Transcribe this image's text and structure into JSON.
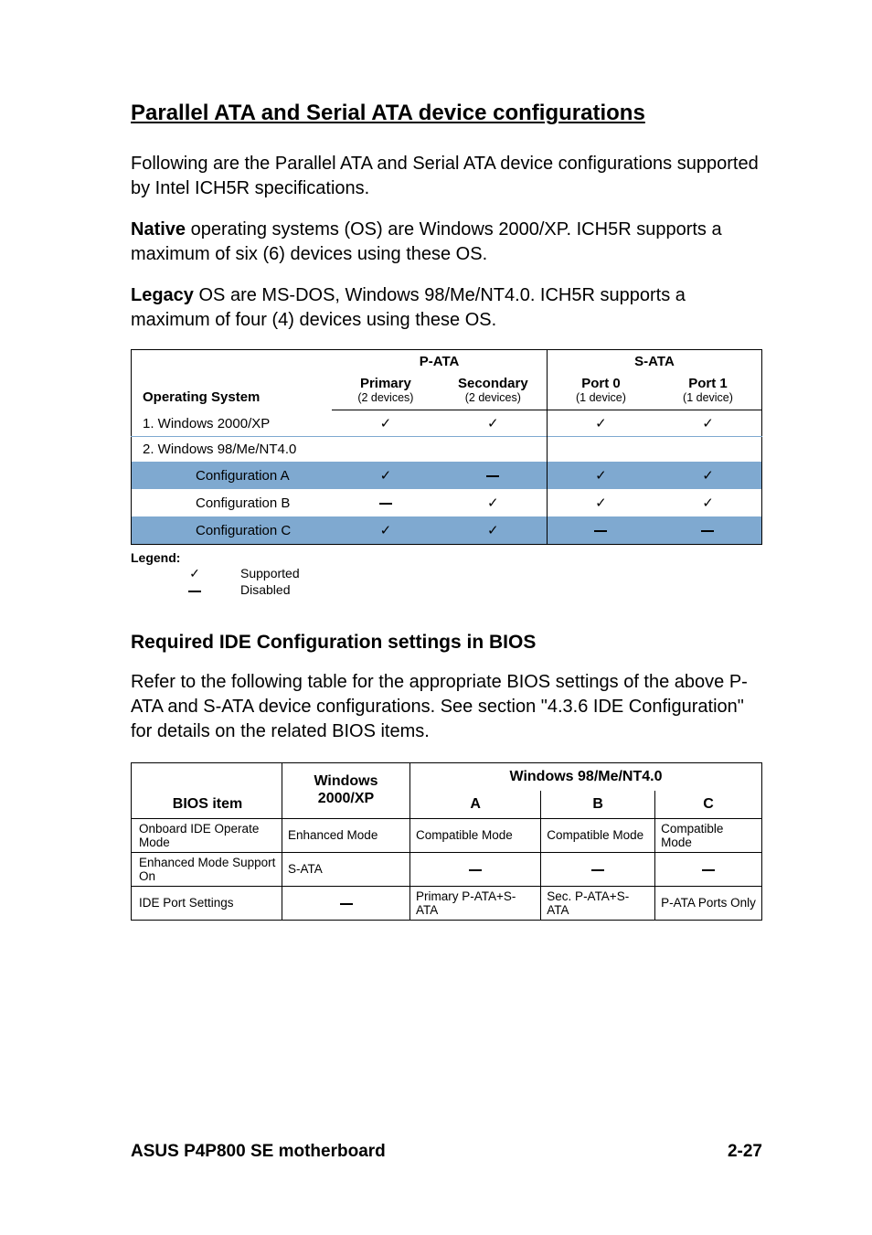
{
  "heading": "Parallel ATA and Serial ATA device configurations",
  "para1": "Following are the Parallel ATA and Serial ATA device configurations supported by Intel ICH5R specifications.",
  "para2_bold": "Native",
  "para2_rest": " operating systems (OS) are Windows 2000/XP. ICH5R supports a maximum of six (6) devices using these OS.",
  "para3_bold": "Legacy",
  "para3_rest": " OS are MS-DOS, Windows 98/Me/NT4.0. ICH5R supports a maximum of four (4) devices using these OS.",
  "t1": {
    "os_header": "Operating System",
    "pata": "P-ATA",
    "sata": "S-ATA",
    "primary": "Primary",
    "primary_sub": "(2 devices)",
    "secondary": "Secondary",
    "secondary_sub": "(2 devices)",
    "port0": "Port 0",
    "port0_sub": "(1 device)",
    "port1": "Port 1",
    "port1_sub": "(1 device)",
    "row1": "1.  Windows 2000/XP",
    "row2": "2.  Windows 98/Me/NT4.0",
    "cfgA": "Configuration A",
    "cfgB": "Configuration B",
    "cfgC": "Configuration C",
    "check": "✓",
    "dash": "—"
  },
  "legend": {
    "title": "Legend:",
    "supported": "Supported",
    "disabled": "Disabled"
  },
  "subheading": "Required IDE Configuration settings in BIOS",
  "para4": "Refer to the following  table for the appropriate BIOS settings of the above P-ATA and S-ATA device configurations. See section \"4.3.6  IDE Configuration\" for details on the related BIOS items.",
  "t2": {
    "bios_item": "BIOS item",
    "windows_2000xp": "Windows 2000/XP",
    "windows_98": "Windows 98/Me/NT4.0",
    "colA": "A",
    "colB": "B",
    "colC": "C",
    "r1_label": "Onboard IDE Operate Mode",
    "r1_w2k": "Enhanced Mode",
    "r1_a": "Compatible Mode",
    "r1_b": "Compatible Mode",
    "r1_c": "Compatible Mode",
    "r2_label": "Enhanced Mode Support On",
    "r2_w2k": "S-ATA",
    "r2_a": "—",
    "r2_b": "—",
    "r2_c": "—",
    "r3_label": "IDE Port Settings",
    "r3_w2k": "—",
    "r3_a": "Primary P-ATA+S-ATA",
    "r3_b": "Sec. P-ATA+S-ATA",
    "r3_c": "P-ATA Ports Only"
  },
  "footer_left": "ASUS P4P800 SE motherboard",
  "footer_right": "2-27",
  "chart_data": [
    {
      "type": "table",
      "title": "Parallel ATA and Serial ATA device configurations support matrix",
      "columns": [
        "Operating System",
        "P-ATA Primary (2 devices)",
        "P-ATA Secondary (2 devices)",
        "S-ATA Port 0 (1 device)",
        "S-ATA Port 1 (1 device)"
      ],
      "rows": [
        {
          "label": "1. Windows 2000/XP",
          "values": [
            "Supported",
            "Supported",
            "Supported",
            "Supported"
          ]
        },
        {
          "label": "2. Windows 98/Me/NT4.0 – Configuration A",
          "values": [
            "Supported",
            "Disabled",
            "Supported",
            "Supported"
          ]
        },
        {
          "label": "2. Windows 98/Me/NT4.0 – Configuration B",
          "values": [
            "Disabled",
            "Supported",
            "Supported",
            "Supported"
          ]
        },
        {
          "label": "2. Windows 98/Me/NT4.0 – Configuration C",
          "values": [
            "Supported",
            "Supported",
            "Disabled",
            "Disabled"
          ]
        }
      ]
    },
    {
      "type": "table",
      "title": "Required IDE Configuration settings in BIOS",
      "columns": [
        "BIOS item",
        "Windows 2000/XP",
        "Windows 98/Me/NT4.0 A",
        "Windows 98/Me/NT4.0 B",
        "Windows 98/Me/NT4.0 C"
      ],
      "rows": [
        {
          "label": "Onboard IDE Operate Mode",
          "values": [
            "Enhanced Mode",
            "Compatible Mode",
            "Compatible Mode",
            "Compatible Mode"
          ]
        },
        {
          "label": "Enhanced Mode Support On",
          "values": [
            "S-ATA",
            "—",
            "—",
            "—"
          ]
        },
        {
          "label": "IDE Port Settings",
          "values": [
            "—",
            "Primary P-ATA+S-ATA",
            "Sec. P-ATA+S-ATA",
            "P-ATA Ports Only"
          ]
        }
      ]
    }
  ]
}
